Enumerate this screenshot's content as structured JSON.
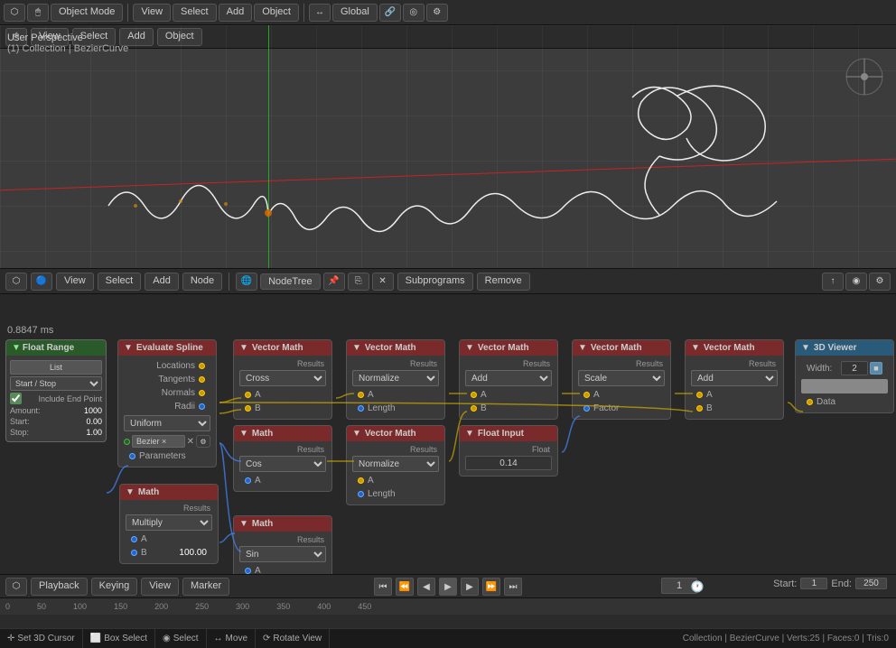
{
  "topbar": {
    "mode": "Object Mode",
    "view": "View",
    "select": "Select",
    "add": "Add",
    "object": "Object",
    "global": "Global"
  },
  "viewport": {
    "title": "User Perspective",
    "collection": "(1) Collection | BezierCurve"
  },
  "node_editor": {
    "view": "View",
    "select": "Select",
    "add": "Add",
    "node": "Node",
    "node_tree": "NodeTree",
    "subprograms": "Subprograms",
    "remove": "Remove",
    "timestamp": "0.8847 ms"
  },
  "float_range": {
    "title": "Float Range",
    "list_btn": "List",
    "mode_select": "Start / Stop",
    "include_end": "Include End Point",
    "amount_label": "Amount:",
    "amount_val": "1000",
    "start_label": "Start:",
    "start_val": "0.00",
    "stop_label": "Stop:",
    "stop_val": "1.00"
  },
  "nodes": {
    "evaluate_spline": {
      "title": "Evaluate Spline",
      "outputs": [
        "Locations",
        "Tangents",
        "Normals",
        "Radii"
      ],
      "uniform": "Uniform",
      "bezier": "Bezier ×",
      "params": "Parameters"
    },
    "math1": {
      "title": "Math",
      "result": "Results",
      "func": "Cos",
      "a_label": "A"
    },
    "math2": {
      "title": "Math",
      "result": "Results",
      "func": "Multiply",
      "a_label": "A",
      "b_label": "B",
      "b_val": "100.00"
    },
    "math3": {
      "title": "Math",
      "result": "Results",
      "func": "Sin",
      "a_label": "A"
    },
    "vector_math1": {
      "title": "Vector Math",
      "result": "Results",
      "func": "Cross",
      "a_label": "A",
      "b_label": "B"
    },
    "vector_math2": {
      "title": "Vector Math",
      "result": "Results",
      "func": "Normalize",
      "a_label": "A",
      "length_label": "Length"
    },
    "vector_math3": {
      "title": "Vector Math",
      "result": "Results",
      "func": "Add",
      "a_label": "A",
      "b_label": "B"
    },
    "vector_math4": {
      "title": "Vector Math",
      "result": "Results",
      "func": "Scale",
      "a_label": "A",
      "factor_label": "Factor"
    },
    "vector_math5": {
      "title": "Vector Math",
      "result": "Results",
      "func": "Add",
      "a_label": "A",
      "b_label": "B"
    },
    "float_input": {
      "title": "Float Input",
      "float_label": "Float",
      "value": "0.14"
    },
    "viewer_3d": {
      "title": "3D Viewer",
      "width_label": "Width:",
      "width_val": "2",
      "data_label": "Data"
    }
  },
  "timeline": {
    "playback": "Playback",
    "keying": "Keying",
    "view_btn": "View",
    "marker_btn": "Marker",
    "frame": "1",
    "start_label": "Start:",
    "start_val": "1",
    "end_label": "End:",
    "end_val": "250"
  },
  "statusbar": {
    "cursor_tool": "Set 3D Cursor",
    "box_select": "Box Select",
    "select": "Select",
    "move": "Move",
    "rotate_view": "Rotate View",
    "stats": "Collection | BezierCurve | Verts:25 | Faces:0 | Tris:0"
  }
}
